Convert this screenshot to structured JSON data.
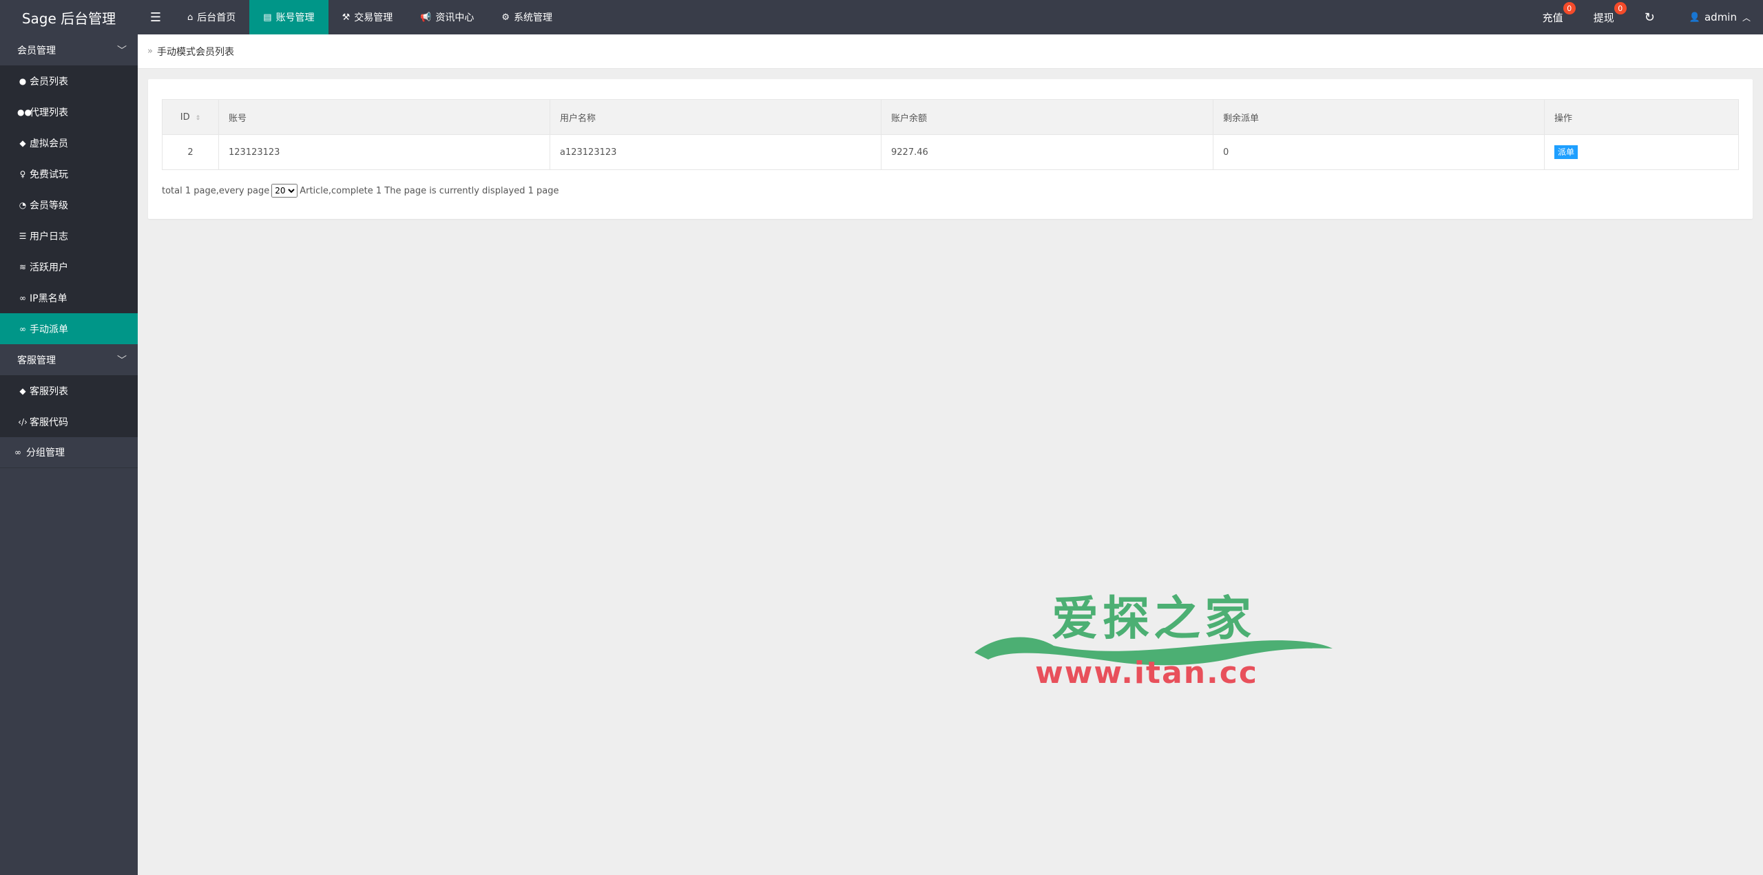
{
  "header": {
    "logo": "Sage 后台管理",
    "nav": [
      {
        "label": "后台首页",
        "icon": "home-icon"
      },
      {
        "label": "账号管理",
        "icon": "id-card-icon",
        "active": true
      },
      {
        "label": "交易管理",
        "icon": "gavel-icon"
      },
      {
        "label": "资讯中心",
        "icon": "bullhorn-icon"
      },
      {
        "label": "系统管理",
        "icon": "cogs-icon"
      }
    ],
    "recharge": {
      "label": "充值",
      "count": "0"
    },
    "withdraw": {
      "label": "提现",
      "count": "0"
    },
    "user": "admin"
  },
  "sidebar": {
    "groups": [
      {
        "title": "会员管理",
        "items": [
          {
            "label": "会员列表",
            "icon": "user-icon"
          },
          {
            "label": "代理列表",
            "icon": "users-icon"
          },
          {
            "label": "虚拟会员",
            "icon": "user-secret-icon"
          },
          {
            "label": "免费试玩",
            "icon": "female-icon"
          },
          {
            "label": "会员等级",
            "icon": "dashboard-icon"
          },
          {
            "label": "用户日志",
            "icon": "list-icon"
          },
          {
            "label": "活跃用户",
            "icon": "wifi-icon"
          },
          {
            "label": "IP黑名单",
            "icon": "link-icon"
          },
          {
            "label": "手动派单",
            "icon": "link-icon",
            "active": true
          }
        ]
      },
      {
        "title": "客服管理",
        "items": [
          {
            "label": "客服列表",
            "icon": "user-secret-icon"
          },
          {
            "label": "客服代码",
            "icon": "code-icon"
          }
        ]
      }
    ],
    "solo": {
      "label": "分组管理",
      "icon": "link-icon"
    }
  },
  "breadcrumb": "手动模式会员列表",
  "table": {
    "headers": [
      "ID",
      "账号",
      "用户名称",
      "账户余额",
      "剩余派单",
      "操作"
    ],
    "rows": [
      {
        "id": "2",
        "account": "123123123",
        "username": "a123123123",
        "balance": "9227.46",
        "remaining": "0",
        "action": "派单"
      }
    ]
  },
  "pager": {
    "prefix": "total 1 page,every page",
    "page_size": "20",
    "suffix": "Article,complete 1 The page is currently displayed 1 page"
  },
  "watermark": {
    "title": "爱探之家",
    "url": "www.itan.cc",
    "green": "#4caf73",
    "red": "#e8505b"
  }
}
